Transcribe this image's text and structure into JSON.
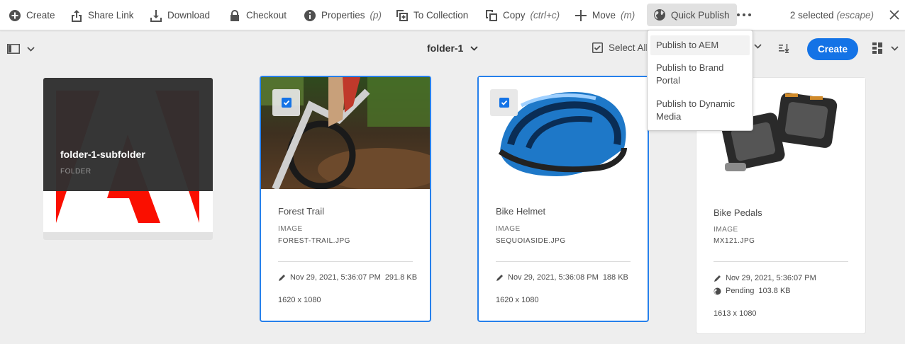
{
  "actionbar": {
    "create": "Create",
    "share_link": "Share Link",
    "download": "Download",
    "checkout": "Checkout",
    "properties": "Properties",
    "properties_shortcut": "(p)",
    "to_collection": "To Collection",
    "copy": "Copy",
    "copy_shortcut": "(ctrl+c)",
    "move": "Move",
    "move_shortcut": "(m)",
    "quick_publish": "Quick Publish",
    "selected": "2 selected",
    "selected_shortcut": "(escape)"
  },
  "quick_publish_menu": [
    {
      "label": "Publish to AEM"
    },
    {
      "label": "Publish to Brand Portal"
    },
    {
      "label": "Publish to Dynamic Media"
    }
  ],
  "titlebar": {
    "folder": "folder-1",
    "select_all": "Select All",
    "create": "Create"
  },
  "folder_card": {
    "name": "folder-1-subfolder",
    "type": "FOLDER"
  },
  "assets": [
    {
      "title": "Forest Trail",
      "type": "IMAGE",
      "file": "FOREST-TRAIL.JPG",
      "modified": "Nov 29, 2021, 5:36:07 PM",
      "size": "291.8 KB",
      "dims": "1620 x 1080",
      "selected": true
    },
    {
      "title": "Bike Helmet",
      "type": "IMAGE",
      "file": "SEQUOIASIDE.JPG",
      "modified": "Nov 29, 2021, 5:36:08 PM",
      "size": "188 KB",
      "dims": "1620 x 1080",
      "selected": true
    },
    {
      "title": "Bike Pedals",
      "type": "IMAGE",
      "file": "MX121.JPG",
      "modified": "Nov 29, 2021, 5:36:07 PM",
      "status": "Pending",
      "size": "103.8 KB",
      "dims": "1613 x 1080",
      "selected": false
    }
  ],
  "colors": {
    "accent": "#1473e6",
    "selection_border": "#2680eb",
    "background": "#eeeeee"
  }
}
